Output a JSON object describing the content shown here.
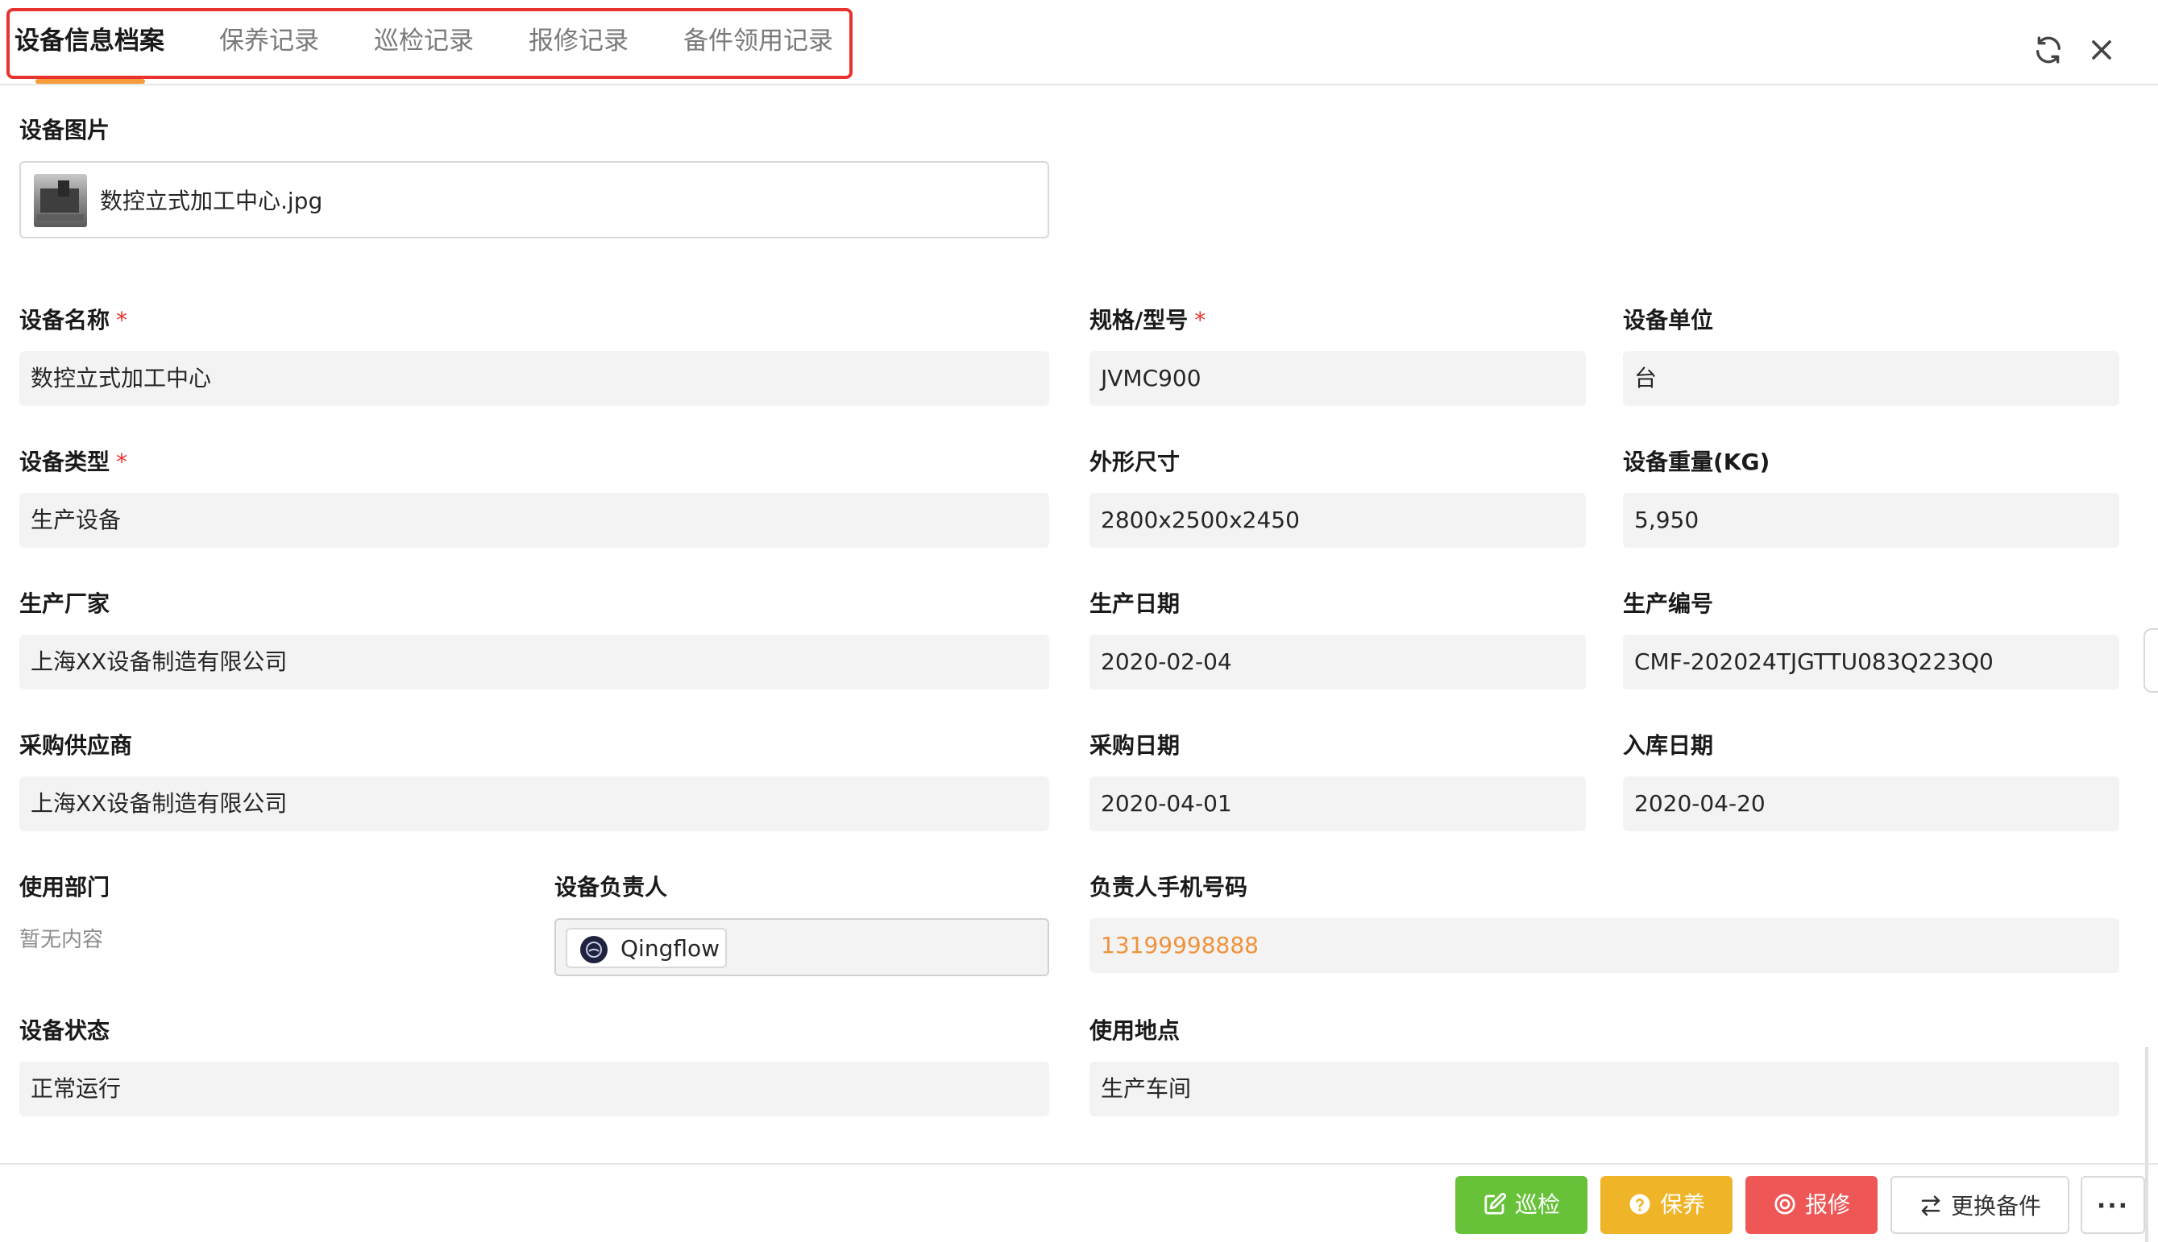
{
  "tabs": [
    {
      "label": "设备信息档案",
      "active": true
    },
    {
      "label": "保养记录",
      "active": false
    },
    {
      "label": "巡检记录",
      "active": false
    },
    {
      "label": "报修记录",
      "active": false
    },
    {
      "label": "备件领用记录",
      "active": false
    }
  ],
  "header_icons": [
    "refresh-icon",
    "close-icon"
  ],
  "form": {
    "image": {
      "label": "设备图片",
      "file_name": "数控立式加工中心.jpg"
    },
    "name": {
      "label": "设备名称",
      "value": "数控立式加工中心",
      "required": "*"
    },
    "model": {
      "label": "规格/型号",
      "value": "JVMC900",
      "required": "*"
    },
    "unit": {
      "label": "设备单位",
      "value": "台"
    },
    "type": {
      "label": "设备类型",
      "value": "生产设备",
      "required": "*"
    },
    "size": {
      "label": "外形尺寸",
      "value": "2800x2500x2450"
    },
    "weight": {
      "label": "设备重量(KG)",
      "value": "5,950"
    },
    "manufacturer": {
      "label": "生产厂家",
      "value": "上海XX设备制造有限公司"
    },
    "prod_date": {
      "label": "生产日期",
      "value": "2020-02-04"
    },
    "prod_no": {
      "label": "生产编号",
      "value": "CMF-202024TJGTTU083Q223Q0"
    },
    "supplier": {
      "label": "采购供应商",
      "value": "上海XX设备制造有限公司"
    },
    "purchase_date": {
      "label": "采购日期",
      "value": "2020-04-01"
    },
    "storage_date": {
      "label": "入库日期",
      "value": "2020-04-20"
    },
    "department": {
      "label": "使用部门",
      "value": "暂无内容"
    },
    "owner": {
      "label": "设备负责人",
      "value": "Qingflow"
    },
    "phone": {
      "label": "负责人手机号码",
      "value": "13199998888"
    },
    "status": {
      "label": "设备状态",
      "value": "正常运行"
    },
    "location": {
      "label": "使用地点",
      "value": "生产车间"
    }
  },
  "footer": {
    "inspect": "巡检",
    "maintain": "保养",
    "repair": "报修",
    "replace_parts": "更换备件",
    "more": "···"
  },
  "colors": {
    "accent": "#f59b3a",
    "highlight_border": "#e8322d",
    "inspect_btn": "#67c23a",
    "maintain_btn": "#f0b429",
    "repair_btn": "#ef5757",
    "phone_text": "#f0913a"
  }
}
